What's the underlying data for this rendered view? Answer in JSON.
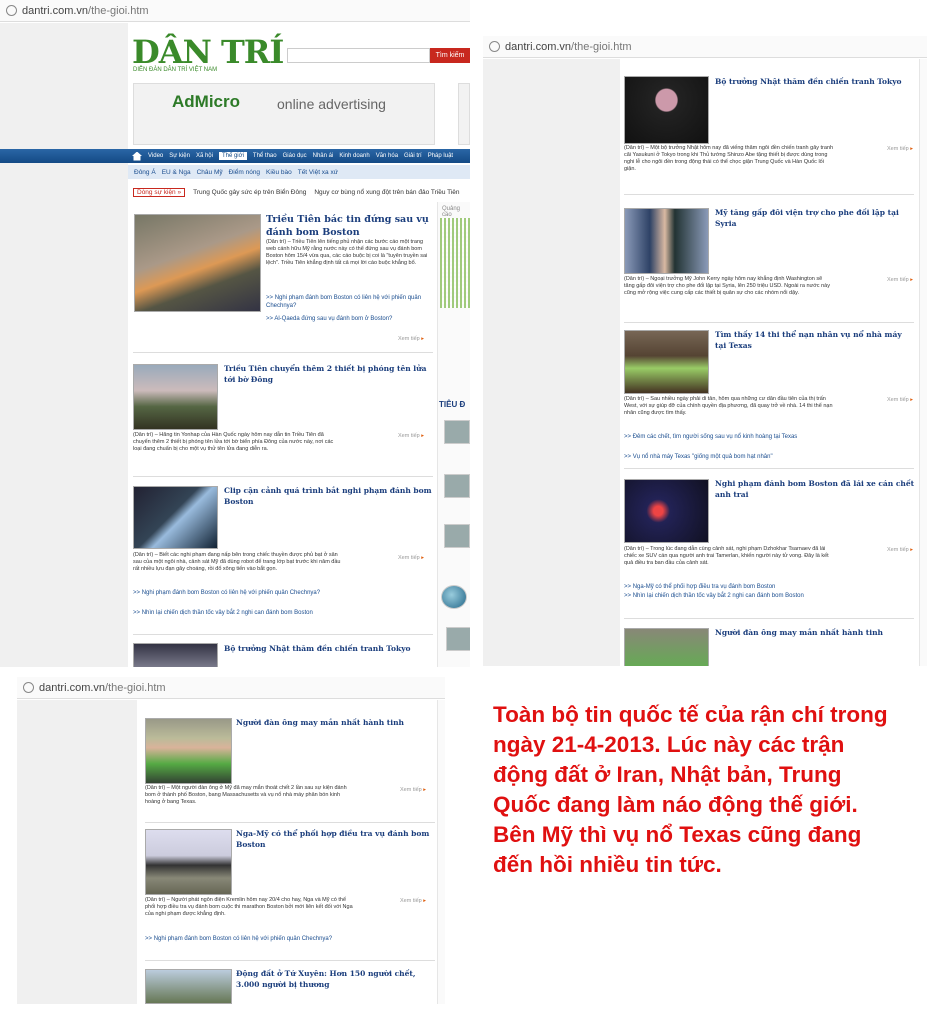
{
  "url": {
    "domain": "dantri.com.vn",
    "path": "/the-gioi.htm"
  },
  "header": {
    "logo": "DÂN TRÍ",
    "tagline": "DIỄN ĐÀN DÂN TRÍ VIỆT NAM",
    "search_button": "Tìm kiếm",
    "banner_logo": "AdMicro",
    "banner_text": "online advertising"
  },
  "nav": [
    "Video",
    "Sự kiện",
    "Xã hội",
    "Thế giới",
    "Thể thao",
    "Giáo dục",
    "Nhân ái",
    "Kinh doanh",
    "Văn hóa",
    "Giải trí",
    "Pháp luật"
  ],
  "subnav": [
    "Đông Á",
    "EU & Nga",
    "Châu Mỹ",
    "Điểm nóng",
    "Kiều bào",
    "Tết Việt xa xứ"
  ],
  "hotbar": {
    "tag": "Dòng sự kiện »",
    "items": [
      "Trung Quốc gây sức ép trên Biển Đông",
      "Nguy cơ bùng nổ xung đột trên bán đảo Triều Tiên"
    ]
  },
  "sidebar": {
    "ad_label": "Quảng cáo",
    "section_title": "TIÊU Đ"
  },
  "articles": {
    "a1": {
      "title": "Triều Tiên bác tin đứng sau vụ đánh bom Boston",
      "summary": "(Dân trí) – Triều Tiên lên tiếng phủ nhận các bước cáo một trang web cánh hữu Mỹ rằng nước này có thể đứng sau vụ đánh bom Boston hôm 15/4 vừa qua, các cáo buộc bị coi là \"tuyên truyền sai lệch\". Triều Tiên khẳng định tất cả mọi lời cáo buộc khẳng bổ.",
      "related": [
        "Nghi phạm đánh bom Boston có liên hệ với phiến quân Chechnya?",
        "Al-Qaeda đứng sau vụ đánh bom ở Boston?"
      ],
      "more": "Xem tiếp"
    },
    "a2": {
      "title": "Triều Tiên chuyển thêm 2 thiết bị phóng tên lửa tới bờ Đông",
      "summary": "(Dân trí) – Hãng tin Yonhap của Hàn Quốc ngày hôm nay dẫn tin Triều Tiên đã chuyển thêm 2 thiết bị phóng tên lửa tới bờ biển phía Đông của nước này, nơi các loại đang chuẩn bị cho một vụ thử tên lửa đang diễn ra.",
      "more": "Xem tiếp"
    },
    "a3": {
      "title": "Clip cận cảnh quá trình bắt nghi phạm đánh bom Boston",
      "summary": "(Dân trí) – Biết các nghi phạm đang nấp bên trong chiếc thuyền được phủ bạt ở sân sau của một ngôi nhà, cảnh sát Mỹ đã dùng robot để trang lớp bạt trước khi nâm đầu rất nhiều lựu đạn gây choáng, rồi đổ xông tiến vào bắt gọn.",
      "related": [
        "Nghi phạm đánh bom Boston có liên hệ với phiến quân Chechnya?",
        "Nhìn lại chiến dịch thần tốc vây bắt 2 nghi can đánh bom Boston"
      ],
      "more": "Xem tiếp"
    },
    "a4": {
      "title": "Bộ trưởng Nhật thăm đền chiến tranh Tokyo",
      "summary": "(Dân trí) – Một bộ trưởng Nhật hôm nay đã viếng thăm ngôi đền chiến tranh gây tranh cãi Yasukuni ở Tokyo trong khi Thủ tướng Shinzo Abe tặng thiết bị được dùng trong nghi lễ cho ngôi đền trong động thái có thể chọc giận Trung Quốc và Hàn Quốc lối giận.",
      "more": "Xem tiếp"
    },
    "a5": {
      "title": "Mỹ tăng gấp đôi viện trợ cho phe đối lập tại Syria",
      "summary": "(Dân trí) – Ngoại trưởng Mỹ John Kerry ngày hôm nay khẳng định Washington sẽ tăng gấp đôi viện trợ cho phe đối lập tại Syria, lên 250 triệu USD. Ngoài ra nước này cũng mở rộng việc cung cấp các thiết bị quân sự cho các nhóm nổi dậy.",
      "more": "Xem tiếp"
    },
    "a6": {
      "title": "Tìm thấy 14 thi thể nạn nhân vụ nổ nhà máy tại Texas",
      "summary": "(Dân trí) – Sau nhiều ngày phải di tản, hôm qua những cư dân đầu tiên của thị trấn West, với sự giúp đỡ của chính quyền địa phương, đã quay trở về nhà. 14 thi thể nạn nhân cũng được tìm thấy.",
      "related": [
        "Đêm các chết, tìm người sống sau vụ nổ kinh hoàng tại Texas",
        "Vụ nổ nhà máy Texas \"giống một quả bom hạt nhân\""
      ],
      "more": "Xem tiếp"
    },
    "a7": {
      "title": "Nghi phạm đánh bom Boston đã lái xe cán chết anh trai",
      "summary": "(Dân trí) – Trong lúc đang dẫn cùng cảnh sát, nghi phạm Dzhokhar Tsarnaev đã lái chiếc xe SUV cán qua người anh trai Tamerlan, khiến người này tử vong. Đây là kết quả điều tra ban đầu của cảnh sát.",
      "related": [
        "Nga-Mỹ có thể phối hợp điều tra vụ đánh bom Boston",
        "Nhìn lại chiến dịch thần tốc vây bắt 2 nghi can đánh bom Boston"
      ],
      "more": "Xem tiếp"
    },
    "a8": {
      "title": "Người đàn ông may mắn nhất hành tinh",
      "summary": "(Dân trí) – Một người đàn ông ở Mỹ đã may mắn thoát chết 2 lần sau sự kiện đánh bom ở thành phố Boston, bang Massachusetts và vụ nổ nhà máy phân bón kinh hoàng ở bang Texas.",
      "more": "Xem tiếp"
    },
    "a9": {
      "title": "Nga-Mỹ có thể phối hợp điều tra vụ đánh bom Boston",
      "summary": "(Dân trí) – Người phát ngôn điện Kremlin hôm nay 20/4 cho hay, Nga và Mỹ có thể phối hợp điều tra vụ đánh bom cuộc thi marathon Boston bởi mới liên kết đối với Nga của nghi phạm được khẳng định.",
      "related": [
        "Nghi phạm đánh bom Boston có liên hệ với phiến quân Chechnya?"
      ],
      "more": "Xem tiếp"
    },
    "a10": {
      "title": "Động đất ở Tứ Xuyên: Hơn 150 người chết, 3.000 người bị thương"
    }
  },
  "caption": "Toàn bộ tin quốc tế của rận chí trong ngày 21-4-2013. Lúc này các trận động đất ở Iran, Nhật bản, Trung Quốc đang làm náo động thế giới. Bên Mỹ thì vụ nổ Texas cũng đang đến hồi nhiều tin tức."
}
